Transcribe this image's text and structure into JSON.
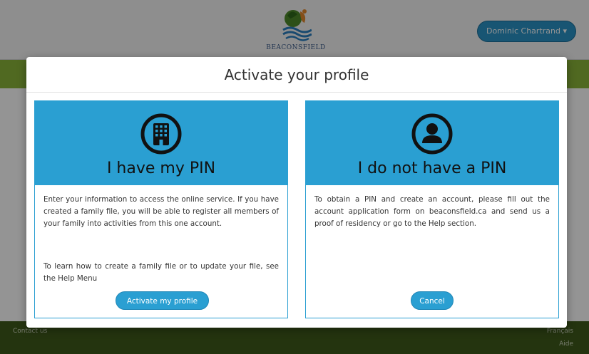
{
  "header": {
    "logo_text": "BEACONSFIELD",
    "user_button_label": "Dominic Chartrand ▾"
  },
  "footer": {
    "contact_label": "Contact us",
    "language_label": "Français",
    "help_label": "Aide"
  },
  "modal": {
    "title": "Activate your profile",
    "cards": [
      {
        "icon": "building-icon",
        "heading": "I have my PIN",
        "paragraph1": "Enter your information to access the online service. If you have created a family file, you will be able to register all members of your family into activities from this one account.",
        "paragraph2": "To learn how to create a family file or to update your file, see the Help Menu",
        "button_label": "Activate my profile"
      },
      {
        "icon": "user-icon",
        "heading": "I do not have a PIN",
        "paragraph1": "To obtain a PIN and create an account, please fill out the account application form on beaconsfield.ca and send us a proof of residency or go to the Help section.",
        "button_label": "Cancel"
      }
    ]
  },
  "colors": {
    "accent_blue": "#2a9fd2",
    "green_bar": "#8ab63a",
    "footer_green": "#3f5a1a"
  }
}
